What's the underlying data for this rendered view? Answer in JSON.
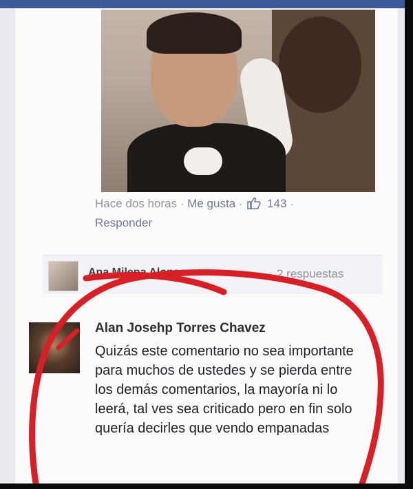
{
  "post": {
    "time": "Hace dos horas",
    "like_link": "Me gusta",
    "like_count": "143",
    "reply_link": "Responder",
    "separator": "·"
  },
  "replies_bar": {
    "name": "Ana Milena Alonso",
    "count_label": "2 respuestas"
  },
  "comment": {
    "author": "Alan Josehp Torres Chavez",
    "text": "Quizás este comentario no sea importante para muchos de ustedes y se pierda entre los demás comentarios, la mayoría ni lo leerá, tal ves sea criticado pero en fin solo quería decirles que vendo empanadas"
  },
  "colors": {
    "facebook_blue": "#3b5998",
    "annotation_red": "#d81f26",
    "meta_gray": "#90949c"
  },
  "icons": [
    "thumbs-up-icon"
  ]
}
